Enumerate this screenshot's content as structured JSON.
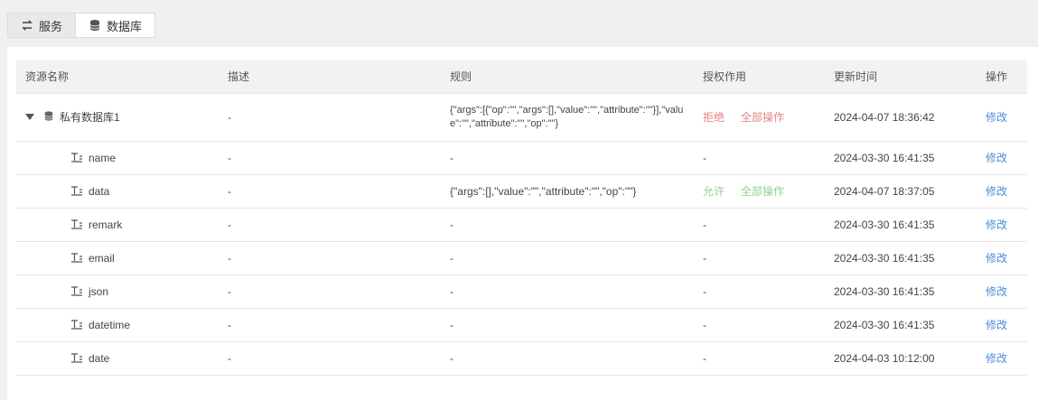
{
  "tabs": [
    {
      "label": "服务",
      "icon": "swap-icon",
      "active": false
    },
    {
      "label": "数据库",
      "icon": "database-icon",
      "active": true
    }
  ],
  "table": {
    "headers": {
      "name": "资源名称",
      "desc": "描述",
      "rule": "规则",
      "auth": "授权作用",
      "updated": "更新时间",
      "op": "操作"
    },
    "parent": {
      "name": "私有数据库1",
      "desc": "-",
      "rule": "{\"args\":[{\"op\":\"\",\"args\":[],\"value\":\"\",\"attribute\":\"\"}],\"value\":\"\",\"attribute\":\"\",\"op\":\"\"}",
      "auth_effect": "拒绝",
      "auth_scope": "全部操作",
      "updated": "2024-04-07 18:36:42",
      "op": "修改"
    },
    "rows": [
      {
        "name": "name",
        "desc": "-",
        "rule": "-",
        "auth": "-",
        "scope": "",
        "updated": "2024-03-30 16:41:35",
        "op": "修改"
      },
      {
        "name": "data",
        "desc": "-",
        "rule": "{\"args\":[],\"value\":\"\",\"attribute\":\"\",\"op\":\"\"}",
        "auth": "允许",
        "scope": "全部操作",
        "updated": "2024-04-07 18:37:05",
        "op": "修改"
      },
      {
        "name": "remark",
        "desc": "-",
        "rule": "-",
        "auth": "-",
        "scope": "",
        "updated": "2024-03-30 16:41:35",
        "op": "修改"
      },
      {
        "name": "email",
        "desc": "-",
        "rule": "-",
        "auth": "-",
        "scope": "",
        "updated": "2024-03-30 16:41:35",
        "op": "修改"
      },
      {
        "name": "json",
        "desc": "-",
        "rule": "-",
        "auth": "-",
        "scope": "",
        "updated": "2024-03-30 16:41:35",
        "op": "修改"
      },
      {
        "name": "datetime",
        "desc": "-",
        "rule": "-",
        "auth": "-",
        "scope": "",
        "updated": "2024-03-30 16:41:35",
        "op": "修改"
      },
      {
        "name": "date",
        "desc": "-",
        "rule": "-",
        "auth": "-",
        "scope": "",
        "updated": "2024-04-03 10:12:00",
        "op": "修改"
      }
    ]
  },
  "colors": {
    "deny": "#e38484",
    "allow": "#8fd18f",
    "link": "#4a8fd8"
  }
}
